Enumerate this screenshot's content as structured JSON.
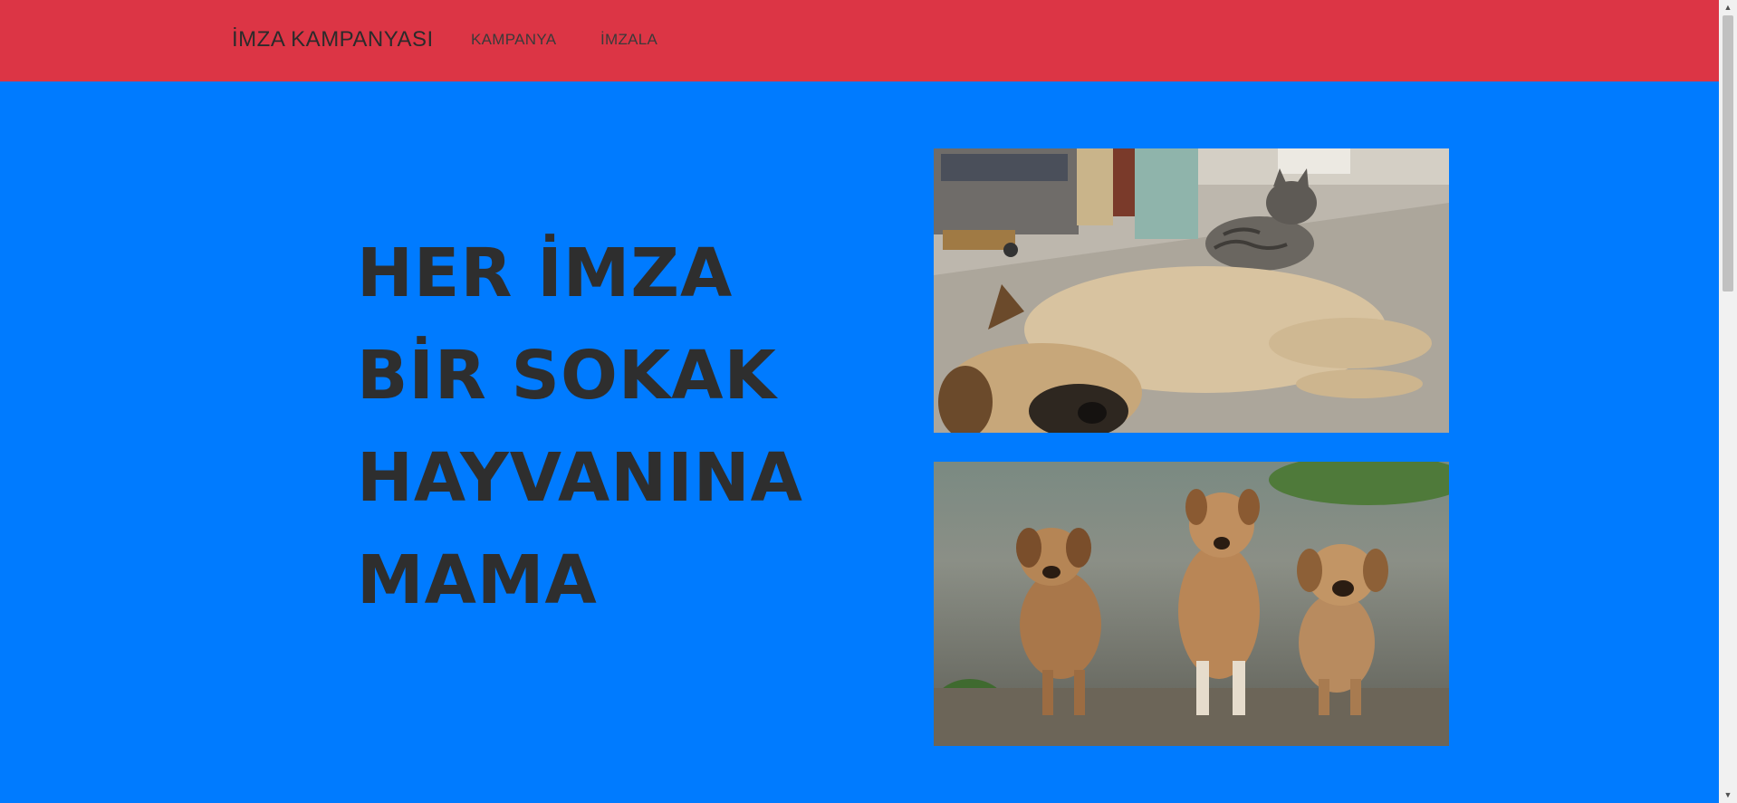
{
  "navbar": {
    "brand": "İMZA KAMPANYASI",
    "links": [
      {
        "label": "KAMPANYA"
      },
      {
        "label": "İMZALA"
      }
    ],
    "background": "#dc3545"
  },
  "hero": {
    "background": "#007bff",
    "headline_lines": [
      "HER İMZA",
      "BİR SOKAK",
      "HAYVANINA",
      "MAMA"
    ],
    "images": [
      {
        "name": "dog-and-cat-photo",
        "alt": "Sleeping dog with a tabby cat"
      },
      {
        "name": "three-puppies-photo",
        "alt": "Three puppies sitting on gravel"
      }
    ]
  },
  "scrollbar": {
    "up_icon": "▲",
    "down_icon": "▼"
  }
}
